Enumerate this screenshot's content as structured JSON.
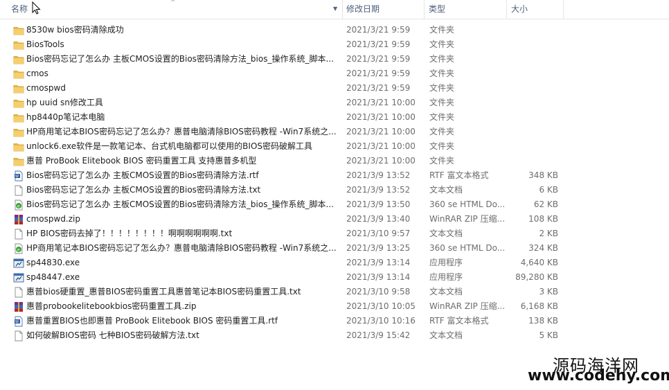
{
  "columns": {
    "name": "名称",
    "date": "修改日期",
    "type": "类型",
    "size": "大小"
  },
  "files": [
    {
      "name": "8530w bios密码清除成功",
      "date": "2021/3/21 9:59",
      "type": "文件夹",
      "size": "",
      "icon": "folder-icon"
    },
    {
      "name": "BiosTools",
      "date": "2021/3/21 9:59",
      "type": "文件夹",
      "size": "",
      "icon": "folder-icon"
    },
    {
      "name": "Bios密码忘记了怎么办 主板CMOS设置的Bios密码清除方法_bios_操作系统_脚本...",
      "date": "2021/3/21 9:59",
      "type": "文件夹",
      "size": "",
      "icon": "folder-icon"
    },
    {
      "name": "cmos",
      "date": "2021/3/21 9:59",
      "type": "文件夹",
      "size": "",
      "icon": "folder-icon"
    },
    {
      "name": "cmospwd",
      "date": "2021/3/21 9:59",
      "type": "文件夹",
      "size": "",
      "icon": "folder-icon"
    },
    {
      "name": "hp uuid sn修改工具",
      "date": "2021/3/21 10:00",
      "type": "文件夹",
      "size": "",
      "icon": "folder-icon"
    },
    {
      "name": "hp8440p笔记本电脑",
      "date": "2021/3/21 10:00",
      "type": "文件夹",
      "size": "",
      "icon": "folder-icon"
    },
    {
      "name": "HP商用笔记本BIOS密码忘记了怎么办？惠普电脑清除BIOS密码教程 -Win7系统之...",
      "date": "2021/3/21 10:00",
      "type": "文件夹",
      "size": "",
      "icon": "folder-icon"
    },
    {
      "name": "unlock6.exe软件是一款笔记本、台式机电脑都可以使用的BIOS密码破解工具",
      "date": "2021/3/21 10:00",
      "type": "文件夹",
      "size": "",
      "icon": "folder-icon"
    },
    {
      "name": "惠普 ProBook Elitebook BIOS 密码重置工具 支持惠普多机型",
      "date": "2021/3/21 10:00",
      "type": "文件夹",
      "size": "",
      "icon": "folder-icon"
    },
    {
      "name": "Bios密码忘记了怎么办 主板CMOS设置的Bios密码清除方法.rtf",
      "date": "2021/3/9 13:52",
      "type": "RTF 富文本格式",
      "size": "348 KB",
      "icon": "rtf-icon"
    },
    {
      "name": "Bios密码忘记了怎么办 主板CMOS设置的Bios密码清除方法.txt",
      "date": "2021/3/9 13:52",
      "type": "文本文档",
      "size": "6 KB",
      "icon": "txt-icon"
    },
    {
      "name": "Bios密码忘记了怎么办 主板CMOS设置的Bios密码清除方法_bios_操作系统_脚本...",
      "date": "2021/3/9 13:50",
      "type": "360 se HTML Do...",
      "size": "62 KB",
      "icon": "html-icon"
    },
    {
      "name": "cmospwd.zip",
      "date": "2021/3/9 13:40",
      "type": "WinRAR ZIP 压缩...",
      "size": "108 KB",
      "icon": "zip-icon"
    },
    {
      "name": "HP BIOS密码去掉了！！！！！！！！啊啊啊啊啊啊.txt",
      "date": "2021/3/10 9:57",
      "type": "文本文档",
      "size": "2 KB",
      "icon": "txt-icon"
    },
    {
      "name": "HP商用笔记本BIOS密码忘记了怎么办？惠普电脑清除BIOS密码教程 -Win7系统之...",
      "date": "2021/3/9 13:25",
      "type": "360 se HTML Do...",
      "size": "324 KB",
      "icon": "html-icon"
    },
    {
      "name": "sp44830.exe",
      "date": "2021/3/9 13:14",
      "type": "应用程序",
      "size": "4,640 KB",
      "icon": "exe-icon"
    },
    {
      "name": "sp48447.exe",
      "date": "2021/3/9 13:14",
      "type": "应用程序",
      "size": "89,280 KB",
      "icon": "exe-icon"
    },
    {
      "name": "惠普bios硬重置_惠普BIOS密码重置工具惠普笔记本BIOS密码重置工具.txt",
      "date": "2021/3/10 9:58",
      "type": "文本文档",
      "size": "3 KB",
      "icon": "txt-icon"
    },
    {
      "name": "惠普probookelitebookbios密码重置工具.zip",
      "date": "2021/3/10 10:05",
      "type": "WinRAR ZIP 压缩...",
      "size": "6,168 KB",
      "icon": "zip-icon"
    },
    {
      "name": "惠普重置BIOS也即惠普 ProBook Elitebook BIOS 密码重置工具.rtf",
      "date": "2021/3/10 10:16",
      "type": "RTF 富文本格式",
      "size": "138 KB",
      "icon": "rtf-icon"
    },
    {
      "name": "如何破解BIOS密码 七种BIOS密码破解方法.txt",
      "date": "2021/3/9 15:42",
      "type": "文本文档",
      "size": "5 KB",
      "icon": "txt-icon"
    }
  ],
  "watermark": {
    "line1": "源码海洋网",
    "line2": "www.codehy.com"
  }
}
